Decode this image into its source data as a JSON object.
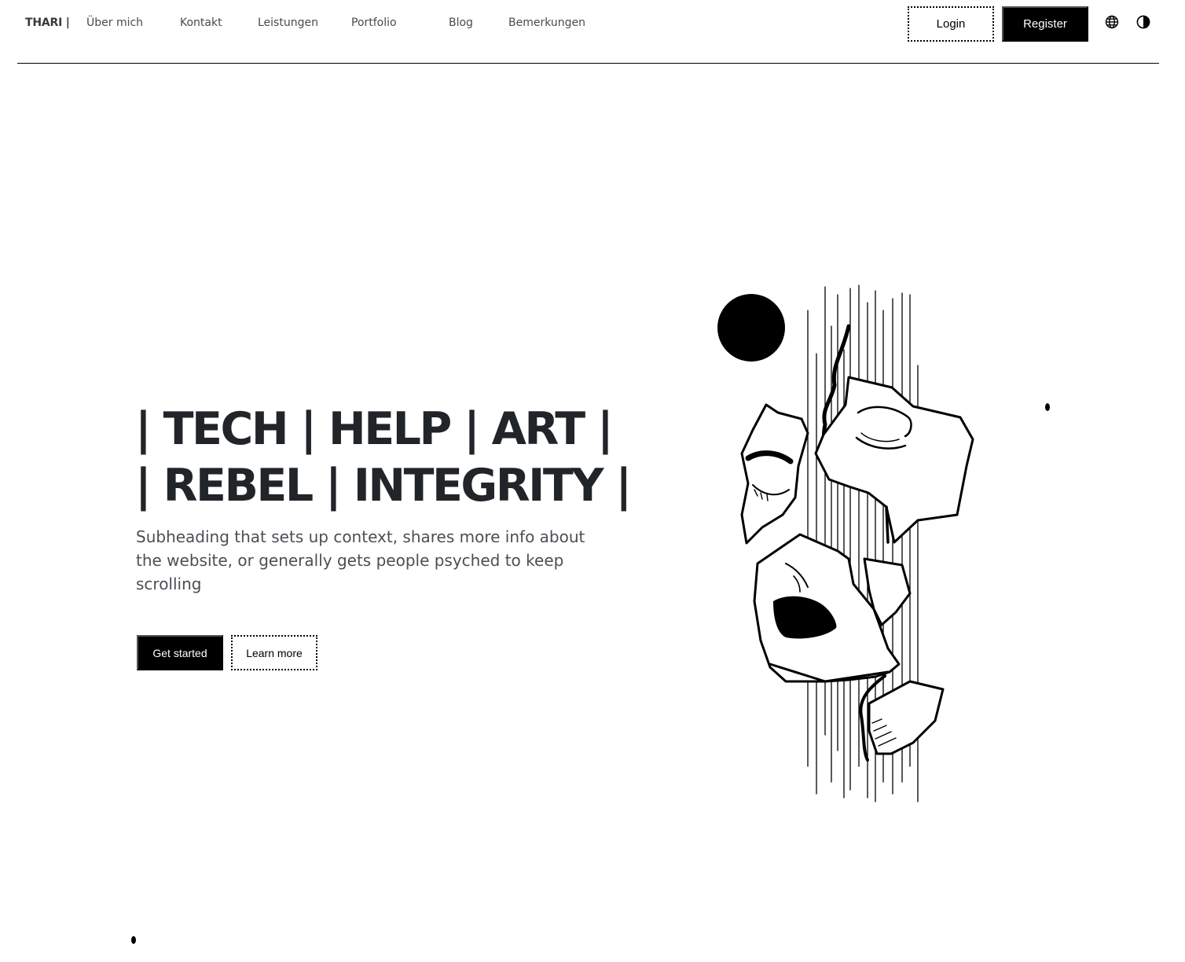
{
  "nav": {
    "brand": "THARI |",
    "links": [
      "Über mich",
      "Kontakt",
      "Leistungen",
      "Portfolio",
      "Blog",
      "Bemerkungen"
    ],
    "login_label": "Login",
    "register_label": "Register",
    "language_icon": "globe-icon",
    "theme_icon": "contrast-icon"
  },
  "hero": {
    "title_line1": "| TECH | HELP | ART |",
    "title_line2": "| REBEL | INTEGRITY |",
    "subheading": "Subheading that sets up context, shares more info about the website, or generally gets people psyched to keep scrolling",
    "primary_label": "Get started",
    "secondary_label": "Learn more"
  },
  "colors": {
    "text": "#212529",
    "accent": "#000000",
    "background": "#ffffff"
  }
}
